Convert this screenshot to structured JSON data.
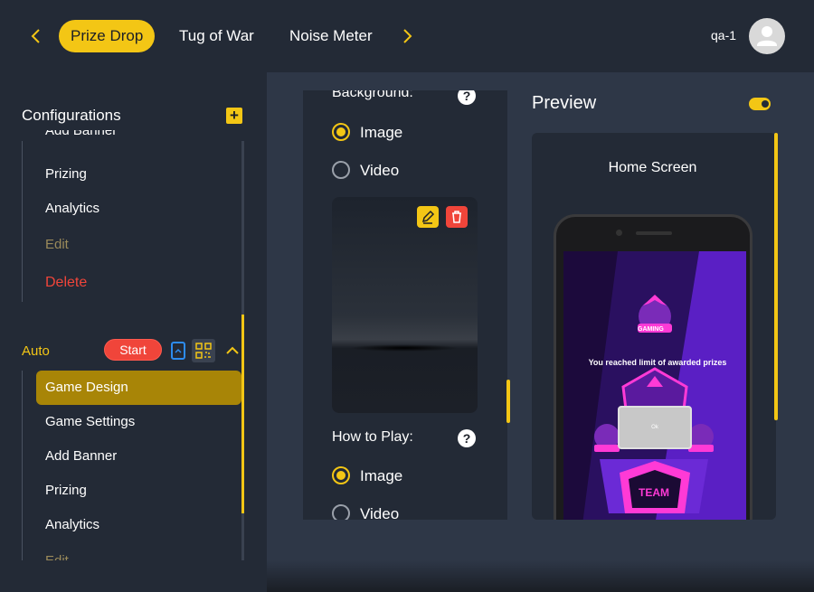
{
  "header": {
    "tabs": [
      {
        "label": "Prize Drop",
        "active": true
      },
      {
        "label": "Tug of War",
        "active": false
      },
      {
        "label": "Noise Meter",
        "active": false
      }
    ],
    "user": "qa-1"
  },
  "sidebar": {
    "title": "Configurations",
    "group1": {
      "items": [
        "Add Banner",
        "Prizing",
        "Analytics",
        "Edit",
        "Delete"
      ]
    },
    "auto": {
      "label": "Auto",
      "start_label": "Start",
      "items": [
        "Game Design",
        "Game Settings",
        "Add Banner",
        "Prizing",
        "Analytics",
        "Edit"
      ]
    }
  },
  "config": {
    "background_label": "Background:",
    "how_to_play_label": "How to Play:",
    "options": {
      "image": "Image",
      "video": "Video"
    },
    "help": "?"
  },
  "preview": {
    "title": "Preview",
    "screen_label": "Home Screen",
    "limit_message": "You reached limit of awarded prizes",
    "ok_label": "Ok",
    "logo_text_1": "GAMING",
    "logo_text_2": "TEAM"
  },
  "colors": {
    "accent": "#f3c615",
    "danger": "#f0453a",
    "bg": "#232a36",
    "main_bg": "#2e3747"
  }
}
